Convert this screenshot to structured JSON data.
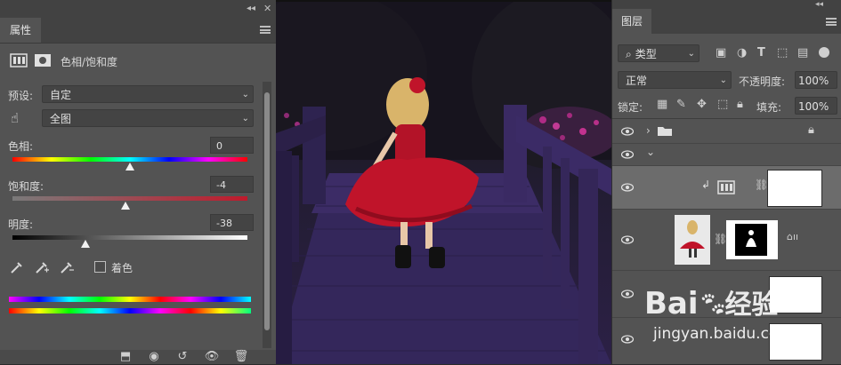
{
  "properties": {
    "tab_label": "属性",
    "header_title": "色相/饱和度",
    "preset_label": "预设:",
    "preset_value": "自定",
    "channel_value": "全图",
    "hue": {
      "label": "色相:",
      "value": "0",
      "level": 0.5
    },
    "saturation": {
      "label": "饱和度:",
      "value": "-4",
      "level": 0.48
    },
    "lightness": {
      "label": "明度:",
      "value": "-38",
      "level": 0.31
    },
    "colorize_label": "着色",
    "colorize_checked": false
  },
  "layers": {
    "tab_label": "图层",
    "filter_label": "类型",
    "blend_mode": "正常",
    "opacity_label": "不透明度:",
    "opacity_value": "100%",
    "lock_label": "锁定:",
    "fill_label": "填充:",
    "fill_value": "100%"
  },
  "watermark": {
    "brand_text": "Bai",
    "brand_suffix": "经验",
    "url": "jingyan.baidu.com"
  },
  "colors": {
    "panel_bg": "#535353",
    "panel_dark": "#424242",
    "selected_row": "#6c6c6c",
    "dress_red": "#c0142a",
    "bridge_purple": "#3a2a63"
  },
  "icons": [
    "grid-adjust-icon",
    "mask-icon",
    "hand-target-icon",
    "eyedropper-icon",
    "eyedropper-plus-icon",
    "eyedropper-minus-icon",
    "clip-to-layer-icon",
    "view-previous-icon",
    "reset-icon",
    "visibility-icon",
    "trash-icon",
    "search-icon",
    "folder-icon",
    "lock-icon",
    "eye-icon",
    "chain-link-icon"
  ]
}
